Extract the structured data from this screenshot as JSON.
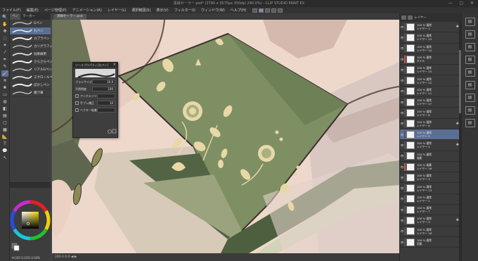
{
  "window": {
    "title": "黒緑セーラー.psd* (3780 x 3575px 350dpi 240.0%) - CLIP STUDIO PAINT EX",
    "controls": "— ▢ ✕"
  },
  "menu": [
    "ファイル(F)",
    "編集(E)",
    "ページ管理(P)",
    "アニメーション(A)",
    "レイヤー(L)",
    "選択範囲(S)",
    "表示(V)",
    "フィルター(I)",
    "ウィンドウ(W)",
    "ヘルプ(H)"
  ],
  "tools": [
    {
      "icon": "zoom-icon",
      "glyph": "🔍"
    },
    {
      "icon": "hand-icon",
      "glyph": "✋"
    },
    {
      "icon": "move-icon",
      "glyph": "✥"
    },
    {
      "icon": "lasso-icon",
      "glyph": "◌"
    },
    {
      "icon": "wand-icon",
      "glyph": "✦"
    },
    {
      "icon": "eyedropper-icon",
      "glyph": "⁄"
    },
    {
      "icon": "pen-icon",
      "glyph": "✒"
    },
    {
      "icon": "pencil-icon",
      "glyph": "✎"
    },
    {
      "icon": "brush-icon",
      "glyph": "🖌"
    },
    {
      "icon": "airbrush-icon",
      "glyph": "≋"
    },
    {
      "icon": "decoration-icon",
      "glyph": "❀"
    },
    {
      "icon": "eraser-icon",
      "glyph": "▭"
    },
    {
      "icon": "blend-icon",
      "glyph": "◍"
    },
    {
      "icon": "fill-icon",
      "glyph": "◧"
    },
    {
      "icon": "gradient-icon",
      "glyph": "▤"
    },
    {
      "icon": "figure-icon",
      "glyph": "▢"
    },
    {
      "icon": "frame-icon",
      "glyph": "▦"
    },
    {
      "icon": "ruler-icon",
      "glyph": "📐"
    },
    {
      "icon": "text-icon",
      "glyph": "T"
    },
    {
      "icon": "balloon-icon",
      "glyph": "💬"
    },
    {
      "icon": "correction-icon",
      "glyph": "↖"
    }
  ],
  "subtool": {
    "tabs": [
      "ペン",
      "マーカー"
    ],
    "brushes": [
      "Gペン",
      "丸ペン",
      "カブラペン",
      "カリグラフィ",
      "効果線用",
      "さらさらペン",
      "リアルGペン",
      "スクロールペン",
      "ぼかしペン",
      "墨汁筆"
    ]
  },
  "color": {
    "values": "H:245  S:31%  V:34%",
    "main_color": "#6b6a4c",
    "sub_color": "#ffffff"
  },
  "canvas": {
    "tab_label": "黒緑セーラー.psd",
    "status": "240.0   0.0   ◀ ▶"
  },
  "tool_property": {
    "title": "ツールプロパティ[丸ペン]",
    "rows": [
      {
        "label": "ブラシサイズ",
        "value": "10.0"
      },
      {
        "label": "不透明度",
        "value": "100"
      },
      {
        "label": "アンチエイリアス",
        "value": ""
      },
      {
        "label": "手ブレ補正",
        "value": "10"
      },
      {
        "label": "ベクター吸着",
        "value": ""
      }
    ]
  },
  "layers": {
    "header": "レイヤー",
    "items": [
      {
        "name": "100 % 通常\nレイヤー 1",
        "clip": "#555555",
        "icon": "✥"
      },
      {
        "name": "100 % 通常\nレイヤー 15",
        "clip": "#555555",
        "icon": ""
      },
      {
        "name": "100 % 通常\nレイヤー 14",
        "clip": "#555555",
        "icon": ""
      },
      {
        "name": "100 % 通常\nホイル",
        "clip": "#c85a4a",
        "icon": ""
      },
      {
        "name": "100 % 通常\nレイヤー 10",
        "clip": "#555555",
        "icon": ""
      },
      {
        "name": "100 % 通常\nレイヤー 12",
        "clip": "#555555",
        "icon": ""
      },
      {
        "name": "100 % 通常\nレイヤー 11",
        "clip": "#555555",
        "icon": ""
      },
      {
        "name": "100 % 通常\nレイヤー 17",
        "clip": "#555555",
        "icon": ""
      },
      {
        "name": "100 % 通常\nレイヤー 8",
        "clip": "#555555",
        "icon": ""
      },
      {
        "name": "100 % 通常\nレイヤー 6",
        "clip": "#555555",
        "icon": "✥"
      },
      {
        "name": "100 % 通常\nレイヤー 5",
        "clip": "#555555",
        "icon": ""
      },
      {
        "name": "100 % 通常\nレイヤー 4",
        "clip": "#555555",
        "icon": "✥"
      },
      {
        "name": "100 % 通常\n陰影",
        "clip": "#555555",
        "icon": ""
      },
      {
        "name": "100 % 乗算\nレイヤー 16",
        "clip": "#c85a4a",
        "icon": ""
      },
      {
        "name": "100 % 通常\nレイヤー 3",
        "clip": "#555555",
        "icon": ""
      },
      {
        "name": "100 % 通常\nレイヤー 13",
        "clip": "#555555",
        "icon": ""
      },
      {
        "name": "100 % 通常\nレイヤー 2",
        "clip": "#555555",
        "icon": ""
      },
      {
        "name": "100 % 通常\nレイヤー 7",
        "clip": "#555555",
        "icon": ""
      },
      {
        "name": "100 % 通常\nレイヤー 9",
        "clip": "#555555",
        "icon": "✥"
      },
      {
        "name": "100 % 通常\nレイヤー 18",
        "clip": "#555555",
        "icon": ""
      },
      {
        "name": "100 % 通常\n用紙",
        "clip": "#555555",
        "icon": ""
      }
    ],
    "selected_index": 10
  },
  "right_icons": [
    {
      "icon": "folder-icon",
      "glyph": "▤"
    },
    {
      "icon": "folder-icon",
      "glyph": "▤"
    },
    {
      "icon": "folder-icon",
      "glyph": "▤"
    },
    {
      "icon": "folder-icon",
      "glyph": "▤"
    },
    {
      "icon": "folder-icon",
      "glyph": "▤"
    },
    {
      "icon": "folder-icon",
      "glyph": "▤"
    },
    {
      "icon": "folder-icon",
      "glyph": "▤"
    },
    {
      "icon": "folder-icon",
      "glyph": "▤"
    },
    {
      "icon": "folder-icon",
      "glyph": "▤"
    }
  ]
}
